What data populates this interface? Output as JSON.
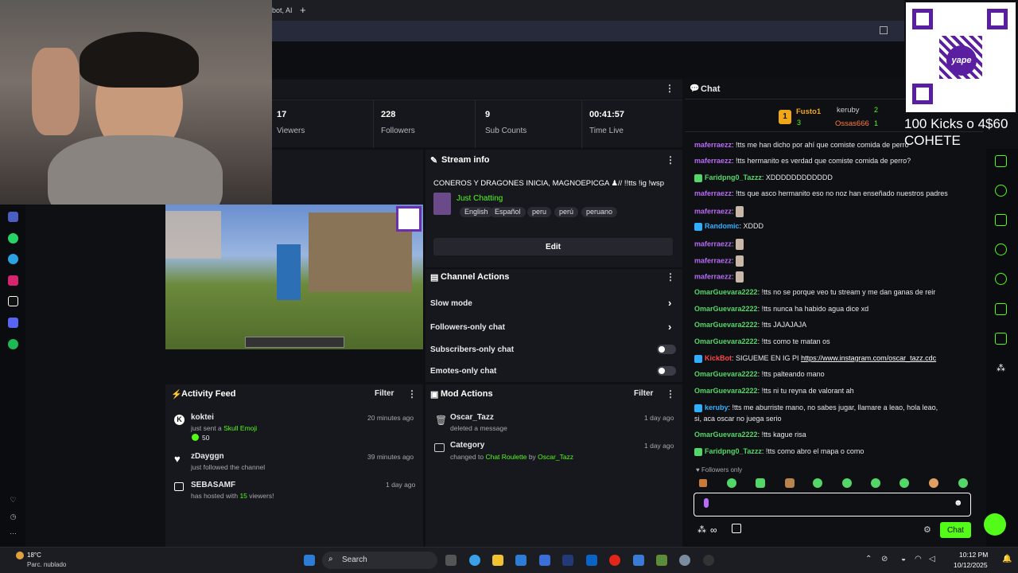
{
  "browser": {
    "tab_text": "bot, AI",
    "new_tab": "+"
  },
  "stats": [
    {
      "value": "17",
      "label": "Viewers"
    },
    {
      "value": "228",
      "label": "Followers"
    },
    {
      "value": "9",
      "label": "Sub Counts"
    },
    {
      "value": "00:41:57",
      "label": "Time Live"
    }
  ],
  "stream_info": {
    "header": "Stream info",
    "title": "CONEROS Y DRAGONES INICIA, MAGNOEPICGA ♟// !!tts !ig !wsp",
    "category": "Just Chatting",
    "tags": [
      "English",
      "Español",
      "peru",
      "perú",
      "peruano"
    ],
    "edit_label": "Edit"
  },
  "channel_actions": {
    "header": "Channel Actions",
    "items": [
      {
        "label": "Slow mode",
        "type": "chevron"
      },
      {
        "label": "Followers-only chat",
        "type": "chevron"
      },
      {
        "label": "Subscribers-only chat",
        "type": "toggle"
      },
      {
        "label": "Emotes-only chat",
        "type": "toggle"
      }
    ]
  },
  "activity_feed": {
    "header": "Activity Feed",
    "filter_label": "Filter",
    "items": [
      {
        "user": "koktei",
        "action": "just sent a",
        "highlight": "Skull Emoji",
        "amount": "50",
        "time": "20 minutes ago"
      },
      {
        "user": "zDayggn",
        "action": "just followed the channel",
        "time": "39 minutes ago"
      },
      {
        "user": "SEBASAMF",
        "action": "has hosted with",
        "highlight": "15",
        "action2": "viewers!",
        "time": "1 day ago"
      }
    ]
  },
  "mod_actions": {
    "header": "Mod Actions",
    "filter_label": "Filter",
    "items": [
      {
        "user": "Oscar_Tazz",
        "action": "deleted a message",
        "time": "1 day ago"
      },
      {
        "user": "Category",
        "action": "changed to",
        "target": "Chat Roulette",
        "by": "by",
        "by_user": "Oscar_Tazz",
        "time": "1 day ago"
      }
    ]
  },
  "chat": {
    "header": "Chat",
    "leaderboard": [
      {
        "rank": "1",
        "name": "Fusto1",
        "count": "3"
      },
      {
        "name": "keruby",
        "count": "2"
      },
      {
        "name": "Ossas666",
        "count": "1"
      }
    ],
    "messages": [
      {
        "user": "maferraezz",
        "color": "pu",
        "text": "!tts me han dicho por ahí que comiste comida de perro"
      },
      {
        "user": "maferraezz",
        "color": "pu",
        "text": "!tts hermanito es verdad que comiste comida de perro?"
      },
      {
        "user": "Faridpng0_Tazzz",
        "color": "gu",
        "text": "XDDDDDDDDDDDD"
      },
      {
        "user": "maferraezz",
        "color": "pu",
        "text": "!tts que asco hermanito eso no noz han enseñado nuestros padres"
      },
      {
        "user": "maferraezz",
        "color": "pu",
        "text": ""
      },
      {
        "user": "Randomic",
        "color": "bu",
        "text": "XDDD"
      },
      {
        "user": "maferraezz",
        "color": "pu",
        "text": ""
      },
      {
        "user": "maferraezz",
        "color": "pu",
        "text": ""
      },
      {
        "user": "maferraezz",
        "color": "pu",
        "text": ""
      },
      {
        "user": "OmarGuevara2222",
        "color": "gu",
        "text": "!tts no se porque veo tu stream y me dan ganas de reir"
      },
      {
        "user": "OmarGuevara2222",
        "color": "gu",
        "text": "!tts nunca ha habido agua dice xd"
      },
      {
        "user": "OmarGuevara2222",
        "color": "gu",
        "text": "!tts JAJAJAJA"
      },
      {
        "user": "OmarGuevara2222",
        "color": "gu",
        "text": "!tts como te matan os"
      },
      {
        "user": "KickBot",
        "color": "ru",
        "text": "SIGUEME EN IG PI",
        "link": "https://www.instagram.com/oscar_tazz.cdc"
      },
      {
        "user": "OmarGuevara2222",
        "color": "gu",
        "text": "!tts palteando mano"
      },
      {
        "user": "OmarGuevara2222",
        "color": "gu",
        "text": "!tts ni tu reyna de valorant ah"
      },
      {
        "user": "keruby",
        "color": "bu",
        "text": "!tts me aburriste mano, no sabes jugar, llamare a leao, hola leao,",
        "text2": "si, aca oscar no juega serio"
      },
      {
        "user": "OmarGuevara2222",
        "color": "gu",
        "text": "!tts kague risa"
      },
      {
        "user": "Faridpng0_Tazzz",
        "color": "gu",
        "text": "!tts como abro el mapa o como"
      }
    ],
    "followers_only": "Followers only",
    "send_label": "Chat"
  },
  "overlay": {
    "kicks_line1": "100 Kicks o 4$60",
    "kicks_line2": "COHETE",
    "qr_brand": "yape"
  },
  "taskbar": {
    "weather_temp": "18°C",
    "weather_desc": "Parc. nublado",
    "search": "Search",
    "time": "10:12 PM",
    "date": "10/12/2025"
  },
  "colors": {
    "accent": "#53fc18",
    "panel": "#17181d",
    "background": "#0f1014"
  }
}
